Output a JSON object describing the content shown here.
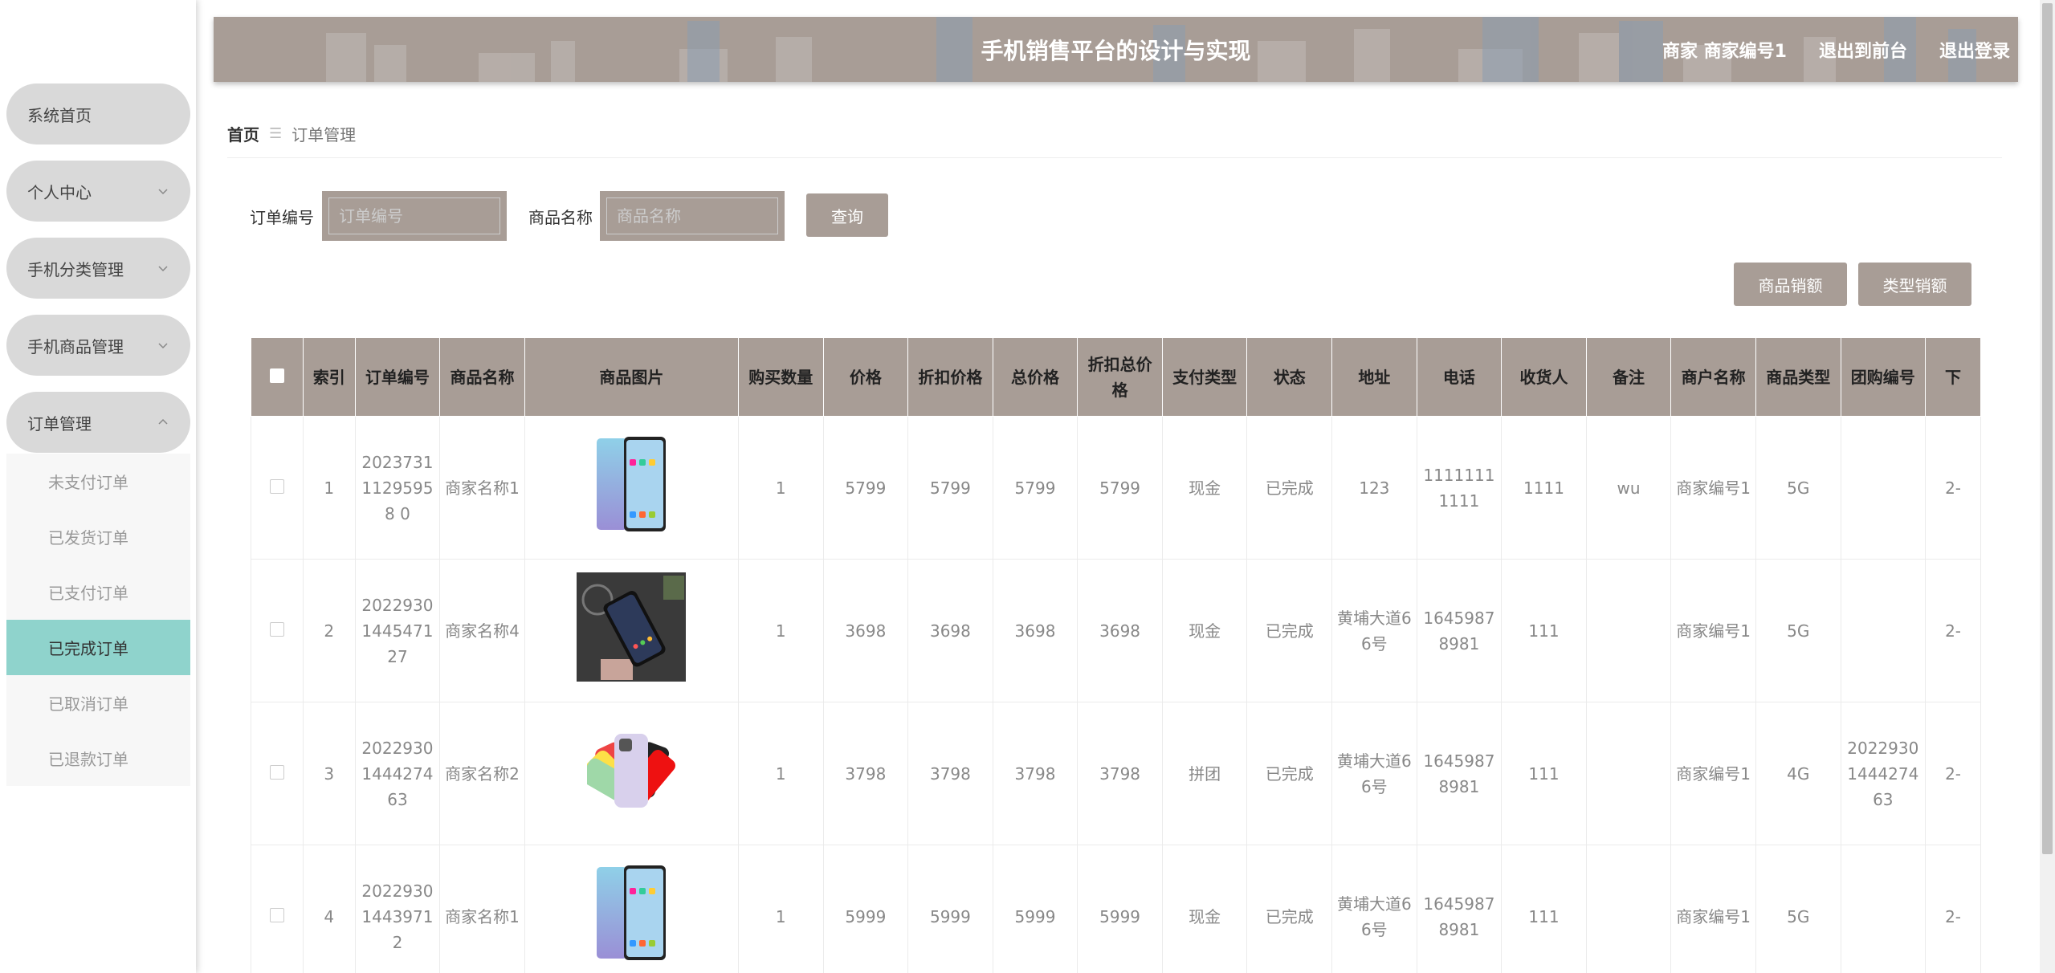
{
  "sidebar": {
    "items": [
      {
        "label": "系统首页"
      },
      {
        "label": "个人中心"
      },
      {
        "label": "手机分类管理"
      },
      {
        "label": "手机商品管理"
      },
      {
        "label": "订单管理"
      }
    ],
    "submenu": [
      {
        "label": "未支付订单"
      },
      {
        "label": "已发货订单"
      },
      {
        "label": "已支付订单"
      },
      {
        "label": "已完成订单"
      },
      {
        "label": "已取消订单"
      },
      {
        "label": "已退款订单"
      }
    ]
  },
  "header": {
    "title": "手机销售平台的设计与实现",
    "user": "商家 商家编号1",
    "front_link": "退出到前台",
    "logout": "退出登录"
  },
  "breadcrumb": {
    "home": "首页",
    "sep": "☰",
    "current": "订单管理"
  },
  "search": {
    "order_label": "订单编号",
    "order_placeholder": "订单编号",
    "product_label": "商品名称",
    "product_placeholder": "商品名称",
    "query": "查询"
  },
  "actions": {
    "sales_amount": "商品销额",
    "type_sales": "类型销额"
  },
  "table": {
    "headers": [
      "索引",
      "订单编号",
      "商品名称",
      "商品图片",
      "购买数量",
      "价格",
      "折扣价格",
      "总价格",
      "折扣总价格",
      "支付类型",
      "状态",
      "地址",
      "电话",
      "收货人",
      "备注",
      "商户名称",
      "商品类型",
      "团购编号",
      "下"
    ],
    "rows": [
      {
        "index": "1",
        "order_no": "202373111295958 0",
        "product": "商家名称1",
        "image": "phone-blue",
        "qty": "1",
        "price": "5799",
        "discount": "5799",
        "total": "5799",
        "discount_total": "5799",
        "pay": "现金",
        "status": "已完成",
        "address": "123",
        "phone": "11111111111",
        "receiver": "1111",
        "note": "wu",
        "merchant": "商家编号1",
        "type": "5G",
        "group": "",
        "extra": "2-"
      },
      {
        "index": "2",
        "order_no": "20229301445471 27",
        "product": "商家名称4",
        "image": "phone-dark",
        "qty": "1",
        "price": "3698",
        "discount": "3698",
        "total": "3698",
        "discount_total": "3698",
        "pay": "现金",
        "status": "已完成",
        "address": "黄埔大道66号",
        "phone": "16459878981",
        "receiver": "111",
        "note": "",
        "merchant": "商家编号1",
        "type": "5G",
        "group": "",
        "extra": "2-"
      },
      {
        "index": "3",
        "order_no": "20229301444274 63",
        "product": "商家名称2",
        "image": "phone-colors",
        "qty": "1",
        "price": "3798",
        "discount": "3798",
        "total": "3798",
        "discount_total": "3798",
        "pay": "拼团",
        "status": "已完成",
        "address": "黄埔大道66号",
        "phone": "16459878981",
        "receiver": "111",
        "note": "",
        "merchant": "商家编号1",
        "type": "4G",
        "group": "2022930144427463",
        "extra": "2-"
      },
      {
        "index": "4",
        "order_no": "20229301443971 2",
        "product": "商家名称1",
        "image": "phone-blue",
        "qty": "1",
        "price": "5999",
        "discount": "5999",
        "total": "5999",
        "discount_total": "5999",
        "pay": "现金",
        "status": "已完成",
        "address": "黄埔大道66号",
        "phone": "16459878981",
        "receiver": "111",
        "note": "",
        "merchant": "商家编号1",
        "type": "5G",
        "group": "",
        "extra": "2-"
      }
    ]
  },
  "colors": {
    "accent": "#a89d96",
    "active": "#8fd3cc",
    "menu_bg": "#d9d9d9"
  }
}
